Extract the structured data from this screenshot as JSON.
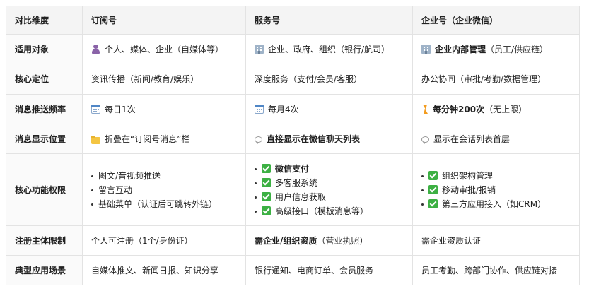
{
  "headers": [
    "对比维度",
    "订阅号",
    "服务号",
    "企业号（企业微信）"
  ],
  "rows": {
    "target": {
      "label": "适用对象",
      "sub": "个人、媒体、企业（自媒体等）",
      "svc": "企业、政府、组织（银行/航司）",
      "ent_bold": "企业内部管理",
      "ent_rest": "（员工/供应链）"
    },
    "position": {
      "label": "核心定位",
      "sub": "资讯传播（新闻/教育/娱乐）",
      "svc": "深度服务（支付/会员/客服）",
      "ent": "办公协同（审批/考勤/数据管理）"
    },
    "frequency": {
      "label": "消息推送频率",
      "sub": "每日1次",
      "svc": "每月4次",
      "ent_bold": "每分钟200次",
      "ent_rest": "（无上限）"
    },
    "display": {
      "label": "消息显示位置",
      "sub": "折叠在“订阅号消息”栏",
      "svc": "直接显示在微信聊天列表",
      "ent": "显示在会话列表首层"
    },
    "features": {
      "label": "核心功能权限",
      "sub": [
        "图文/音视频推送",
        "留言互动",
        "基础菜单（认证后可跳转外链）"
      ],
      "svc": [
        "微信支付",
        "多客服系统",
        "用户信息获取",
        "高级接口（模板消息等）"
      ],
      "ent": [
        "组织架构管理",
        "移动审批/报销",
        "第三方应用接入（如CRM）"
      ]
    },
    "register": {
      "label": "注册主体限制",
      "sub": "个人可注册（1个/身份证）",
      "svc_bold": "需企业/组织资质",
      "svc_rest": "（营业执照）",
      "ent": "需企业资质认证"
    },
    "scenario": {
      "label": "典型应用场景",
      "sub": "自媒体推文、新闻日报、知识分享",
      "svc": "银行通知、电商订单、会员服务",
      "ent": "员工考勤、跨部门协作、供应链对接"
    }
  },
  "icons": {
    "target": [
      "person-icon",
      "building-icon",
      "building-icon"
    ],
    "frequency": [
      "calendar-icon",
      "calendar-icon",
      "lightning-icon"
    ],
    "display": [
      "folder-icon",
      "speech-bubble-icon",
      "speech-bubble-icon"
    ],
    "features": [
      "check-box-icon"
    ]
  }
}
